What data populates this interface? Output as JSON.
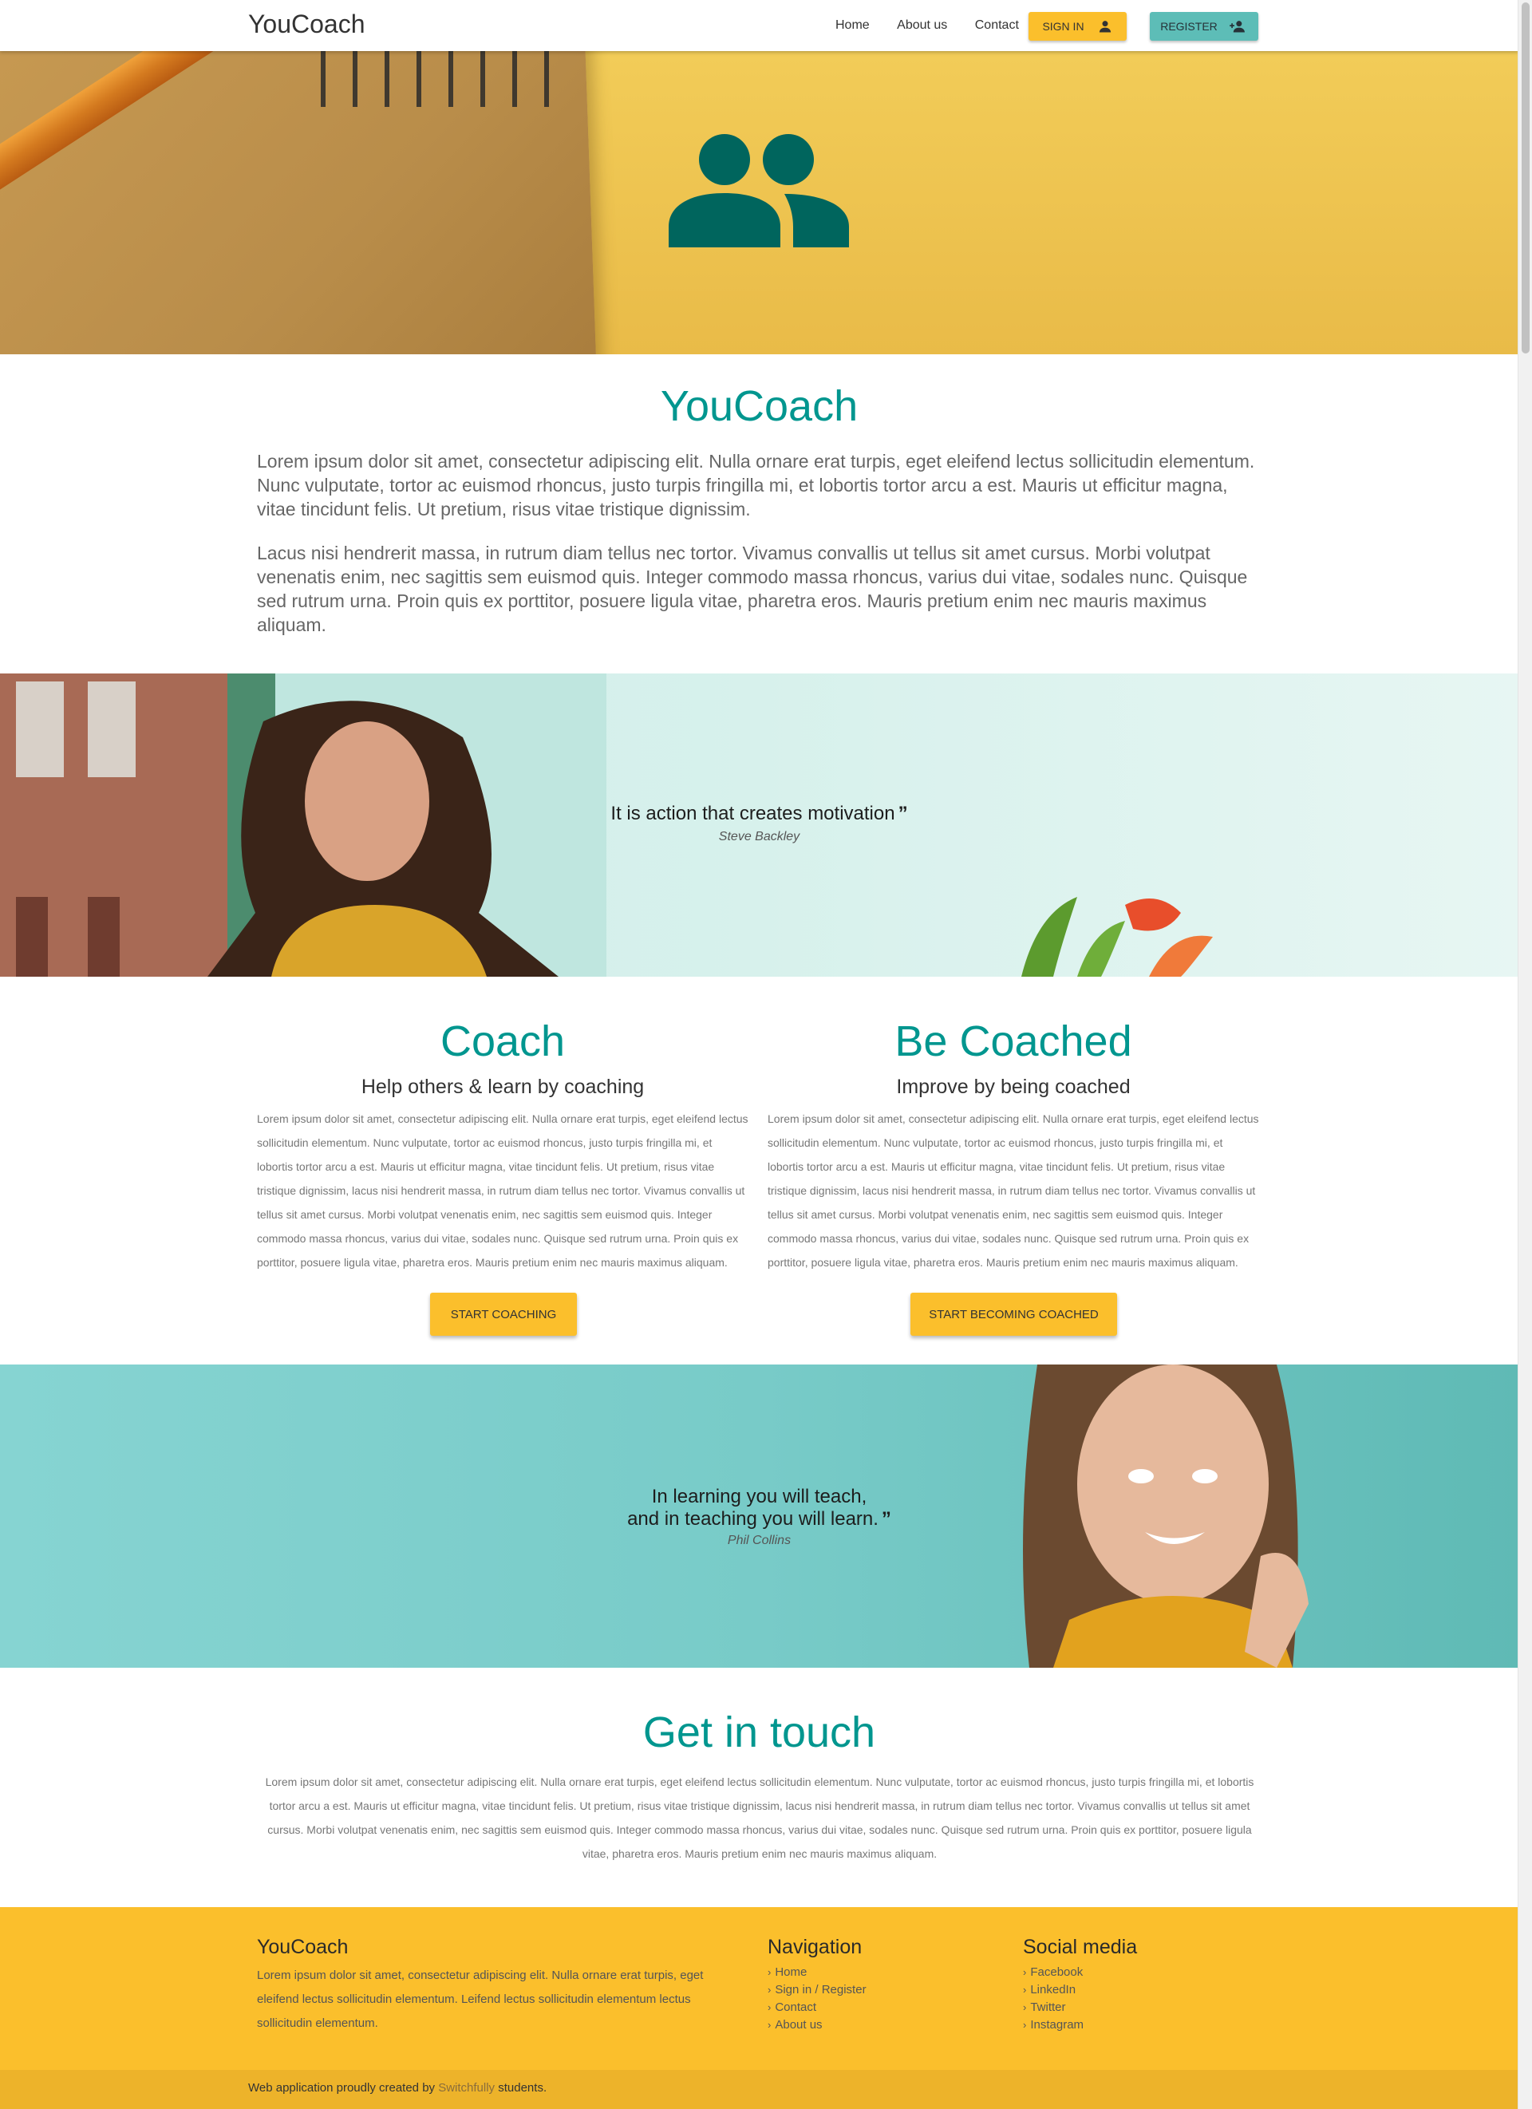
{
  "nav": {
    "brand": "YouCoach",
    "links": [
      "Home",
      "About us",
      "Contact"
    ],
    "signin_label": "SIGN IN",
    "register_label": "REGISTER"
  },
  "about": {
    "title": "YouCoach",
    "paragraphs": [
      "Lorem ipsum dolor sit amet, consectetur adipiscing elit. Nulla ornare erat turpis, eget eleifend lectus sollicitudin elementum. Nunc vulputate, tortor ac euismod rhoncus, justo turpis fringilla mi, et lobortis tortor arcu a est. Mauris ut efficitur magna, vitae tincidunt felis. Ut pretium, risus vitae tristique dignissim.",
      "Lacus nisi hendrerit massa, in rutrum diam tellus nec tortor. Vivamus convallis ut tellus sit amet cursus. Morbi volutpat venenatis enim, nec sagittis sem euismod quis. Integer commodo massa rhoncus, varius dui vitae, sodales nunc. Quisque sed rutrum urna. Proin quis ex porttitor, posuere ligula vitae, pharetra eros. Mauris pretium enim nec mauris maximus aliquam."
    ]
  },
  "quote1": {
    "text": "It is action that creates motivation",
    "author": "Steve Backley"
  },
  "coach": {
    "title": "Coach",
    "subtitle": "Help others & learn by coaching",
    "body": "Lorem ipsum dolor sit amet, consectetur adipiscing elit. Nulla ornare erat turpis, eget eleifend lectus sollicitudin elementum. Nunc vulputate, tortor ac euismod rhoncus, justo turpis fringilla mi, et lobortis tortor arcu a est. Mauris ut efficitur magna, vitae tincidunt felis. Ut pretium, risus vitae tristique dignissim, lacus nisi hendrerit massa, in rutrum diam tellus nec tortor. Vivamus convallis ut tellus sit amet cursus. Morbi volutpat venenatis enim, nec sagittis sem euismod quis. Integer commodo massa rhoncus, varius dui vitae, sodales nunc. Quisque sed rutrum urna. Proin quis ex porttitor, posuere ligula vitae, pharetra eros. Mauris pretium enim nec mauris maximus aliquam.",
    "button": "START COACHING"
  },
  "coached": {
    "title": "Be Coached",
    "subtitle": "Improve by being coached",
    "body": "Lorem ipsum dolor sit amet, consectetur adipiscing elit. Nulla ornare erat turpis, eget eleifend lectus sollicitudin elementum. Nunc vulputate, tortor ac euismod rhoncus, justo turpis fringilla mi, et lobortis tortor arcu a est. Mauris ut efficitur magna, vitae tincidunt felis. Ut pretium, risus vitae tristique dignissim, lacus nisi hendrerit massa, in rutrum diam tellus nec tortor. Vivamus convallis ut tellus sit amet cursus. Morbi volutpat venenatis enim, nec sagittis sem euismod quis. Integer commodo massa rhoncus, varius dui vitae, sodales nunc. Quisque sed rutrum urna. Proin quis ex porttitor, posuere ligula vitae, pharetra eros. Mauris pretium enim nec mauris maximus aliquam.",
    "button": "START BECOMING COACHED"
  },
  "quote2": {
    "line1": "In learning you will teach,",
    "line2": "and in teaching you will learn.",
    "author": "Phil Collins"
  },
  "touch": {
    "title": "Get in touch",
    "body": "Lorem ipsum dolor sit amet, consectetur adipiscing elit. Nulla ornare erat turpis, eget eleifend lectus sollicitudin elementum. Nunc vulputate, tortor ac euismod rhoncus, justo turpis fringilla mi, et lobortis tortor arcu a est. Mauris ut efficitur magna, vitae tincidunt felis. Ut pretium, risus vitae tristique dignissim, lacus nisi hendrerit massa, in rutrum diam tellus nec tortor. Vivamus convallis ut tellus sit amet cursus. Morbi volutpat venenatis enim, nec sagittis sem euismod quis. Integer commodo massa rhoncus, varius dui vitae, sodales nunc. Quisque sed rutrum urna. Proin quis ex porttitor, posuere ligula vitae, pharetra eros. Mauris pretium enim nec mauris maximus aliquam."
  },
  "footer": {
    "brand": "YouCoach",
    "about": "Lorem ipsum dolor sit amet, consectetur adipiscing elit. Nulla ornare erat turpis, eget eleifend lectus sollicitudin elementum. Leifend lectus sollicitudin elementum lectus sollicitudin elementum.",
    "nav_title": "Navigation",
    "nav_links": [
      "Home",
      "Sign in / Register",
      "Contact",
      "About us"
    ],
    "social_title": "Social media",
    "social_links": [
      "Facebook",
      "LinkedIn",
      "Twitter",
      "Instagram"
    ],
    "copyright_prefix": "Web application proudly created by",
    "copyright_link": "Switchfully",
    "copyright_suffix": "students."
  },
  "icons": {
    "signin": "person-icon",
    "register": "person-add-icon",
    "hero": "people-icon",
    "quote": "closing-quote-icon",
    "chevron": "chevron-right-icon"
  },
  "colors": {
    "primary": "#00968f",
    "accent": "#fbbf2c",
    "teal_button": "#5dbdb7",
    "footer_bottom": "#edb32a"
  }
}
